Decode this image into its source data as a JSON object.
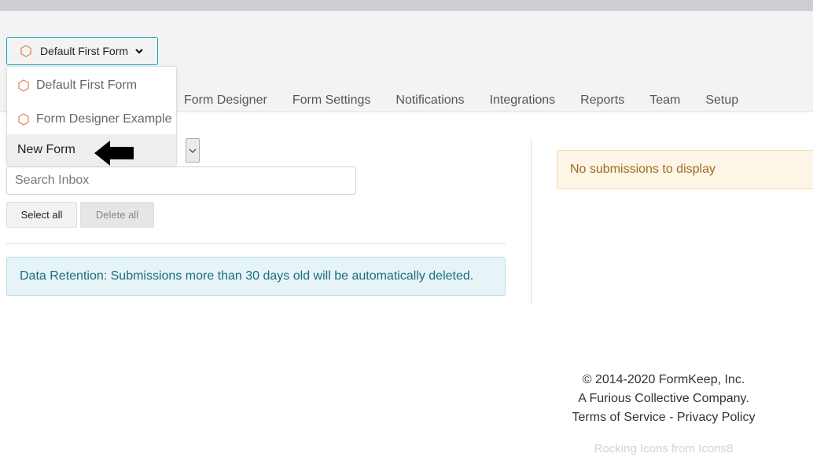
{
  "form_selector": {
    "label": "Default First Form",
    "icon": "hexagon-icon"
  },
  "dropdown": {
    "items": [
      {
        "label": "Default First Form",
        "icon": "hexagon-icon"
      },
      {
        "label": "Form Designer Example",
        "icon": "hexagon-icon"
      },
      {
        "label": "New Form"
      }
    ]
  },
  "tabs": [
    "Form Designer",
    "Form Settings",
    "Notifications",
    "Integrations",
    "Reports",
    "Team",
    "Setup"
  ],
  "inbox": {
    "search_placeholder": "Search Inbox",
    "select_all": "Select all",
    "delete_all": "Delete all"
  },
  "alerts": {
    "retention": "Data Retention: Submissions more than 30 days old will be automatically deleted.",
    "no_submissions": "No submissions to display"
  },
  "footer": {
    "copyright": "© 2014-2020 FormKeep, Inc.",
    "tagline": "A Furious Collective Company.",
    "terms": "Terms of Service",
    "separator": " - ",
    "privacy": "Privacy Policy",
    "credits": "Rocking Icons from Icons8"
  },
  "colors": {
    "accent": "#17a2b8",
    "hexagon": "#e8825a",
    "info_bg": "#e6f4f7",
    "warning_bg": "#fdf5e6"
  }
}
